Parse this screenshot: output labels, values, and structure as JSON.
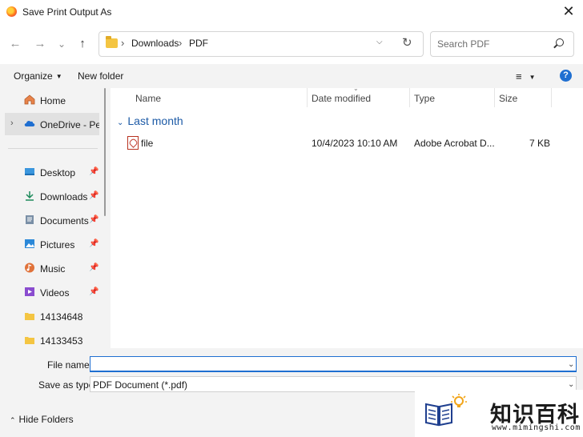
{
  "window": {
    "title": "Save Print Output As",
    "close_glyph": "✕"
  },
  "nav": {
    "back_glyph": "←",
    "forward_glyph": "→",
    "recent_glyph": "⌄",
    "up_glyph": "↑"
  },
  "address": {
    "crumbs": [
      "Downloads",
      "PDF"
    ],
    "sep_glyph": "›"
  },
  "search": {
    "placeholder": "Search PDF"
  },
  "commandbar": {
    "organize": "Organize",
    "new_folder": "New folder",
    "help": "?"
  },
  "sidebar": {
    "items": [
      {
        "label": "Home",
        "icon": "home-icon"
      },
      {
        "label": "OneDrive - Personal",
        "icon": "cloud-icon"
      },
      {
        "label": "Desktop",
        "icon": "desktop-icon"
      },
      {
        "label": "Downloads",
        "icon": "download-icon"
      },
      {
        "label": "Documents",
        "icon": "documents-icon"
      },
      {
        "label": "Pictures",
        "icon": "pictures-icon"
      },
      {
        "label": "Music",
        "icon": "music-icon"
      },
      {
        "label": "Videos",
        "icon": "videos-icon"
      },
      {
        "label": "14134648",
        "icon": "folder-icon"
      },
      {
        "label": "14133453",
        "icon": "folder-icon"
      }
    ]
  },
  "list": {
    "columns": [
      "Name",
      "Date modified",
      "Type",
      "Size"
    ],
    "group": "Last month",
    "rows": [
      {
        "name": "file",
        "date": "10/4/2023 10:10 AM",
        "type": "Adobe Acrobat D...",
        "size": "7 KB"
      }
    ]
  },
  "form": {
    "file_name_label": "File name:",
    "file_name_value": "",
    "save_type_label": "Save as type:",
    "save_type_value": "PDF Document (*.pdf)",
    "hide_folders": "Hide Folders"
  },
  "watermark": {
    "cn": "知识百科",
    "url": "www.mimingshi.com"
  },
  "colors": {
    "accent": "#1f6fd1",
    "group": "#1c5aa6",
    "pane": "#f3f3f3"
  }
}
